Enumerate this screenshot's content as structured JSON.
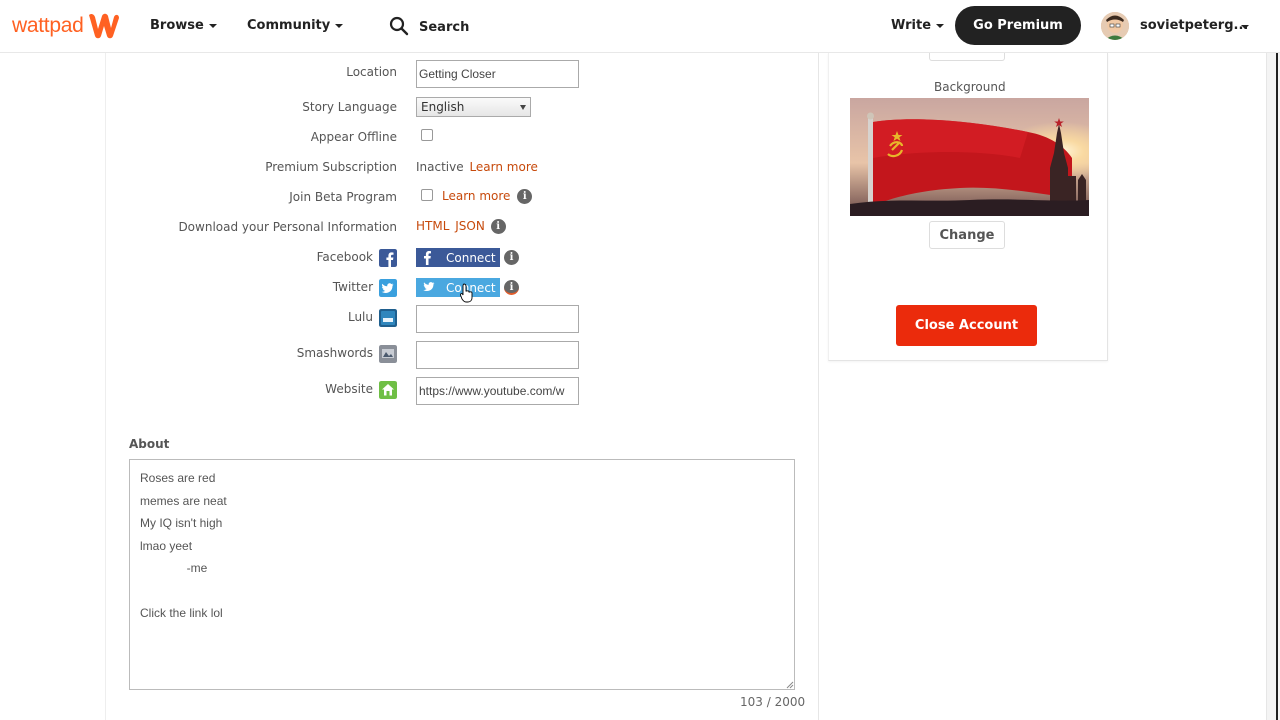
{
  "header": {
    "logo_text": "wattpad",
    "nav_browse": "Browse",
    "nav_community": "Community",
    "search_placeholder": "Search",
    "nav_write": "Write",
    "premium_label": "Go Premium",
    "username": "sovietpeterg..."
  },
  "form": {
    "location": {
      "label": "Location",
      "value": "Getting Closer"
    },
    "story_language": {
      "label": "Story Language",
      "value": "English"
    },
    "appear_offline": {
      "label": "Appear Offline"
    },
    "premium": {
      "label": "Premium Subscription",
      "status": "Inactive",
      "link": "Learn more"
    },
    "beta": {
      "label": "Join Beta Program",
      "link": "Learn more"
    },
    "download": {
      "label": "Download your Personal Information",
      "html": "HTML",
      "json": "JSON"
    },
    "facebook": {
      "label": "Facebook",
      "button": "Connect"
    },
    "twitter": {
      "label": "Twitter",
      "button": "Connect"
    },
    "lulu": {
      "label": "Lulu",
      "value": ""
    },
    "smashwords": {
      "label": "Smashwords",
      "value": ""
    },
    "website": {
      "label": "Website",
      "value": "https://www.youtube.com/w"
    },
    "info_glyph": "i"
  },
  "about": {
    "label": "About",
    "text": "Roses are red\nmemes are neat\nMy IQ isn't high\nlmao yeet\n              -me\n\nClick the link lol",
    "counter": "103 / 2000"
  },
  "sidebar": {
    "background_label": "Background",
    "change_label": "Change",
    "close_account_label": "Close Account"
  },
  "colors": {
    "brand": "#ff6122",
    "link": "#c74a0c",
    "danger": "#eb2b0c",
    "facebook": "#3b5998",
    "twitter": "#4aa8e0"
  }
}
